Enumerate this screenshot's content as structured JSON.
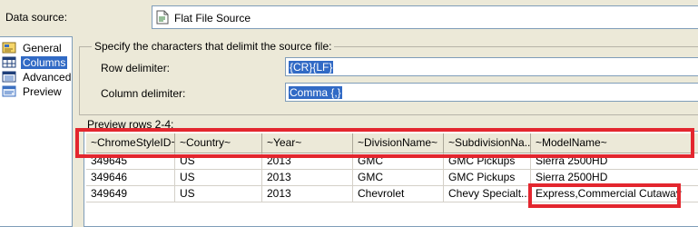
{
  "data_source": {
    "label": "Data source:",
    "value": "Flat File Source",
    "icon": "flat-file-icon"
  },
  "nav": {
    "items": [
      {
        "label": "General",
        "icon": "general-icon",
        "selected": false
      },
      {
        "label": "Columns",
        "icon": "columns-icon",
        "selected": true
      },
      {
        "label": "Advanced",
        "icon": "advanced-icon",
        "selected": false
      },
      {
        "label": "Preview",
        "icon": "preview-icon",
        "selected": false
      }
    ]
  },
  "delimiters": {
    "group_title": "Specify the characters that delimit the source file:",
    "row_label": "Row delimiter:",
    "row_value": "{CR}{LF}",
    "column_label": "Column delimiter:",
    "column_value": "Comma {,}"
  },
  "preview": {
    "label": "Preview rows 2-4:",
    "columns": [
      "~ChromeStyleID~",
      "~Country~",
      "~Year~",
      "~DivisionName~",
      "~SubdivisionNa...",
      "~ModelName~"
    ],
    "rows": [
      [
        "349645",
        "US",
        "2013",
        "GMC",
        "GMC Pickups",
        "Sierra 2500HD"
      ],
      [
        "349646",
        "US",
        "2013",
        "GMC",
        "GMC Pickups",
        "Sierra 2500HD"
      ],
      [
        "349649",
        "US",
        "2013",
        "Chevrolet",
        "Chevy Specialt...",
        "Express,Commercial Cutaway"
      ]
    ]
  },
  "colors": {
    "highlight": "#e3262e",
    "selection": "#316ac5",
    "dialog_bg": "#ece9d8"
  }
}
